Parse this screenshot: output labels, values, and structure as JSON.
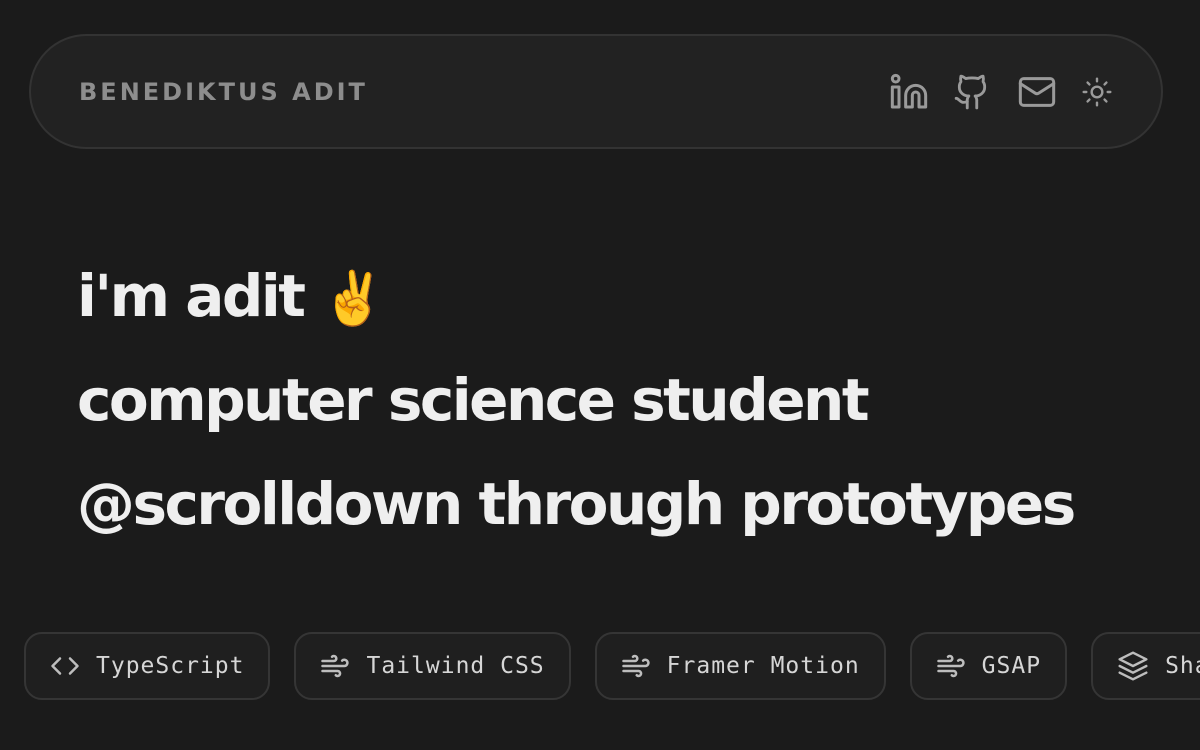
{
  "header": {
    "brand": "BENEDIKTUS ADIT",
    "icons": [
      "linkedin-icon",
      "github-icon",
      "mail-icon",
      "sun-icon"
    ]
  },
  "hero": {
    "line1": "i'm adit",
    "line1_emoji": "✌️",
    "line2": "computer science student",
    "line3": "@scrolldown through prototypes"
  },
  "tech_stack": [
    {
      "label": "TypeScript",
      "icon": "code-icon"
    },
    {
      "label": "Tailwind CSS",
      "icon": "wind-icon"
    },
    {
      "label": "Framer Motion",
      "icon": "wind-icon"
    },
    {
      "label": "GSAP",
      "icon": "wind-icon"
    },
    {
      "label": "Sha",
      "icon": "layers-icon"
    }
  ],
  "colors": {
    "background": "#1b1b1b",
    "navbar": "#222222",
    "heading": "#efefef",
    "muted": "#8d8d8d"
  }
}
